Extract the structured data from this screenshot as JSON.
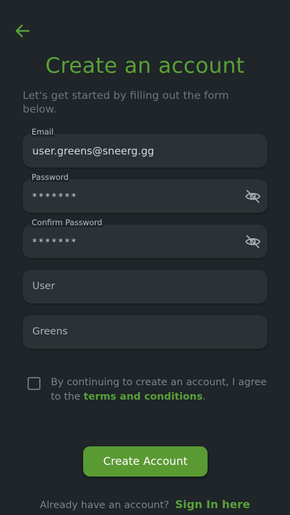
{
  "header": {
    "title": "Create an account",
    "subtitle": "Let's get started by filling out the form below."
  },
  "form": {
    "email": {
      "label": "Email",
      "value": "user.greens@sneerg.gg"
    },
    "password": {
      "label": "Password",
      "value": "*******"
    },
    "confirm_password": {
      "label": "Confirm Password",
      "value": "*******"
    },
    "first_name": {
      "value": "User"
    },
    "last_name": {
      "value": "Greens"
    }
  },
  "terms": {
    "text": "By continuing to create an account, I agree to the",
    "link": "terms and conditions",
    "suffix": "."
  },
  "actions": {
    "create_account": "Create Account",
    "have_account": "Already have an account?",
    "sign_in": "Sign In here"
  },
  "icons": {
    "back": "arrow-left-icon",
    "toggle_visibility": "eye-off-icon"
  },
  "colors": {
    "background": "#1f2528",
    "field": "#2b3135",
    "accent": "#5aa03a",
    "button": "#5a9a33"
  }
}
